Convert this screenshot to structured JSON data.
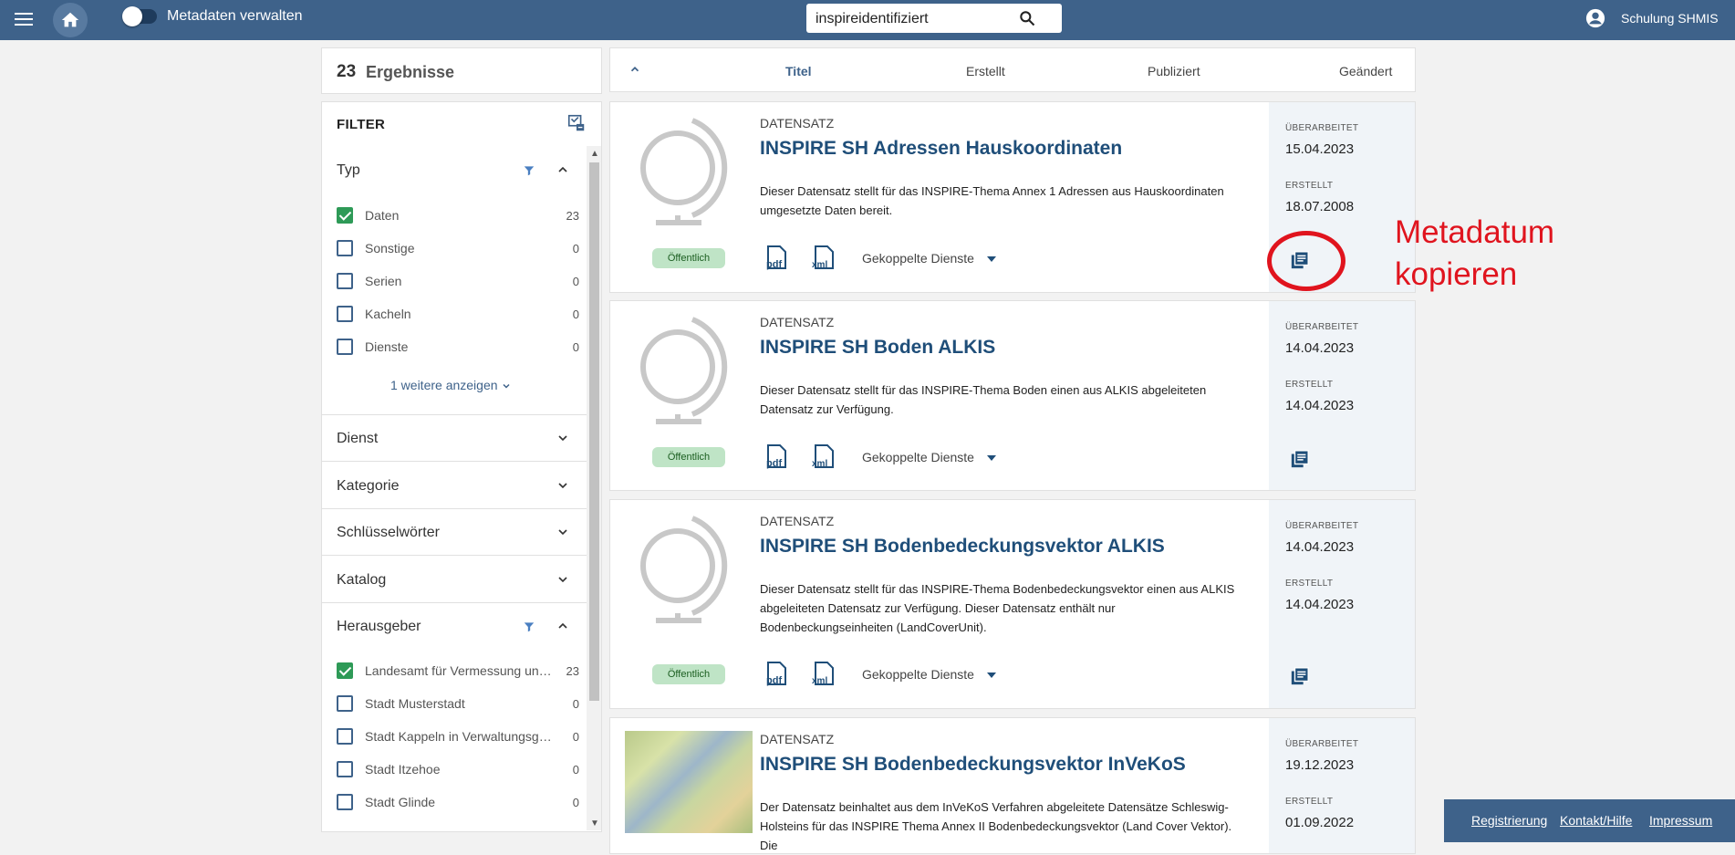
{
  "header": {
    "toggle_label": "Metadaten verwalten",
    "search_value": "inspireidentifiziert",
    "user_name": "Schulung SHMIS"
  },
  "results": {
    "count": "23",
    "label": "Ergebnisse"
  },
  "sort": {
    "items": [
      "Titel",
      "Erstellt",
      "Publiziert",
      "Geändert"
    ],
    "active": "Titel"
  },
  "filter": {
    "title": "FILTER",
    "typ": {
      "label": "Typ",
      "options": [
        {
          "label": "Daten",
          "count": "23",
          "checked": true
        },
        {
          "label": "Sonstige",
          "count": "0",
          "checked": false
        },
        {
          "label": "Serien",
          "count": "0",
          "checked": false
        },
        {
          "label": "Kacheln",
          "count": "0",
          "checked": false
        },
        {
          "label": "Dienste",
          "count": "0",
          "checked": false
        }
      ],
      "more": "1 weitere anzeigen"
    },
    "collapsed_sections": [
      "Dienst",
      "Kategorie",
      "Schlüsselwörter",
      "Katalog"
    ],
    "herausgeber": {
      "label": "Herausgeber",
      "options": [
        {
          "label": "Landesamt für Vermessung und ...",
          "count": "23",
          "checked": true
        },
        {
          "label": "Stadt Musterstadt",
          "count": "0",
          "checked": false
        },
        {
          "label": "Stadt Kappeln in Verwaltungsge...",
          "count": "0",
          "checked": false
        },
        {
          "label": "Stadt Itzehoe",
          "count": "0",
          "checked": false
        },
        {
          "label": "Stadt Glinde",
          "count": "0",
          "checked": false
        }
      ]
    }
  },
  "result_items": [
    {
      "kind": "DATENSATZ",
      "title": "INSPIRE SH Adressen Hauskoordinaten",
      "desc_lines": [
        "Dieser Datensatz stellt für das INSPIRE-Thema Annex 1 Adressen aus Hauskoordinaten",
        "umgesetzte Daten bereit."
      ],
      "badge": "Öffentlich",
      "coupled": "Gekoppelte Dienste",
      "updated_label": "ÜBERARBEITET",
      "updated": "15.04.2023",
      "created_label": "ERSTELLT",
      "created": "18.07.2008"
    },
    {
      "kind": "DATENSATZ",
      "title": "INSPIRE SH Boden ALKIS",
      "desc_lines": [
        "Dieser Datensatz stellt für das INSPIRE-Thema Boden einen aus ALKIS abgeleiteten",
        "Datensatz zur Verfügung."
      ],
      "badge": "Öffentlich",
      "coupled": "Gekoppelte Dienste",
      "updated_label": "ÜBERARBEITET",
      "updated": "14.04.2023",
      "created_label": "ERSTELLT",
      "created": "14.04.2023"
    },
    {
      "kind": "DATENSATZ",
      "title": "INSPIRE SH Bodenbedeckungsvektor ALKIS",
      "desc_lines": [
        "Dieser Datensatz stellt für das INSPIRE-Thema Bodenbedeckungsvektor einen aus ALKIS",
        "abgeleiteten Datensatz zur Verfügung. Dieser Datensatz enthält nur",
        "Bodenbeckungseinheiten (LandCoverUnit)."
      ],
      "badge": "Öffentlich",
      "coupled": "Gekoppelte Dienste",
      "updated_label": "ÜBERARBEITET",
      "updated": "14.04.2023",
      "created_label": "ERSTELLT",
      "created": "14.04.2023"
    },
    {
      "kind": "DATENSATZ",
      "title": "INSPIRE SH Bodenbedeckungsvektor InVeKoS",
      "desc_lines": [
        "Der Datensatz beinhaltet aus dem InVeKoS Verfahren abgeleitete Datensätze Schleswig-",
        "Holsteins für das INSPIRE Thema Annex II Bodenbedeckungsvektor (Land Cover Vektor). Die"
      ],
      "updated_label": "ÜBERARBEITET",
      "updated": "19.12.2023",
      "created_label": "ERSTELLT",
      "created": "01.09.2022"
    }
  ],
  "annotation": {
    "line1": "Metadatum",
    "line2": "kopieren"
  },
  "footer": {
    "links": [
      "Registrierung",
      "Kontakt/Hilfe",
      "Impressum"
    ]
  }
}
